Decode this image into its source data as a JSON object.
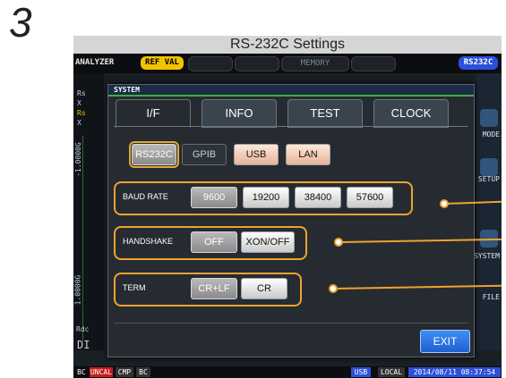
{
  "step_number": "3",
  "banner_title": "RS-232C Settings",
  "topbar": {
    "analyzer": "ANALYZER",
    "ref_val": "REF VAL",
    "memory": "MEMORY",
    "rs232c": "RS232C"
  },
  "background": {
    "labels": [
      "Rs",
      "X",
      "Rs",
      "X"
    ],
    "axis_top": "-1.0000G",
    "axis_bottom": "1.0000G",
    "rdc": "Rdc",
    "di": "DI"
  },
  "right_menu": [
    "MODE",
    "SETUP",
    "SYSTEM",
    "FILE"
  ],
  "bottombar": {
    "items": [
      "BC",
      "UNCAL",
      "CMP",
      "BC"
    ],
    "usb": "USB",
    "local": "LOCAL",
    "datetime": "2014/08/11 08:37:54"
  },
  "dialog": {
    "title": "SYSTEM",
    "tabs": [
      "I/F",
      "INFO",
      "TEST",
      "CLOCK"
    ],
    "active_tab": "I/F",
    "interfaces": [
      "RS232C",
      "GPIB",
      "USB",
      "LAN"
    ],
    "selected_interface": "RS232C",
    "baud_rate": {
      "label": "BAUD RATE",
      "options": [
        "9600",
        "19200",
        "38400",
        "57600"
      ],
      "selected": "9600"
    },
    "handshake": {
      "label": "HANDSHAKE",
      "options": [
        "OFF",
        "XON/OFF"
      ],
      "selected": "OFF"
    },
    "term": {
      "label": "TERM",
      "options": [
        "CR+LF",
        "CR"
      ],
      "selected": "CR+LF"
    },
    "exit_label": "EXIT"
  },
  "colors": {
    "highlight": "#f0a22c",
    "ref_val": "#f2c400",
    "rs232c": "#2c50d8",
    "exit": "#2a74e8"
  }
}
